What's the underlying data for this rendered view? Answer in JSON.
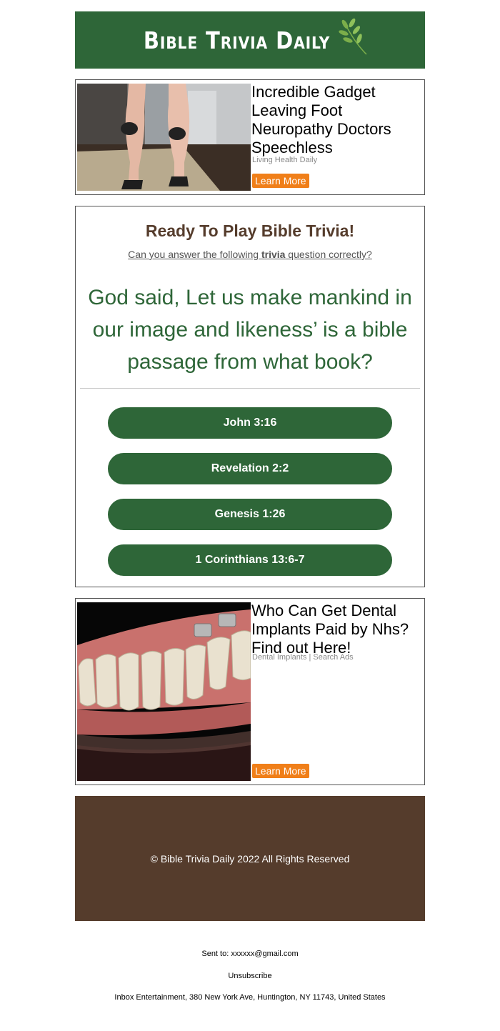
{
  "header": {
    "logo_text": "Bible Trivia Daily",
    "bg_color": "#2e6638"
  },
  "ad1": {
    "title": "Incredible Gadget Leaving Foot Neuropathy Doctors Speechless",
    "source": "Living Health Daily",
    "button_label": "Learn More"
  },
  "trivia": {
    "title": "Ready To Play Bible Trivia!",
    "subtitle_before": "Can you answer the following ",
    "subtitle_bold": "trivia",
    "subtitle_after": " question correctly?",
    "question": "God said, Let us make mankind in our image and likeness’ is a bible passage from what book?",
    "answers": [
      {
        "label": "John 3:16"
      },
      {
        "label": "Revelation 2:2"
      },
      {
        "label": "Genesis 1:26"
      },
      {
        "label": "1 Corinthians 13:6-7"
      }
    ],
    "accent_color": "#2e6638",
    "title_color": "#553c2c"
  },
  "ad2": {
    "title": "Who Can Get Dental Implants Paid by Nhs? Find out Here!",
    "source": "Dental Implants | Search Ads",
    "button_label": "Learn More"
  },
  "footer": {
    "copyright": "© Bible Trivia Daily 2022 All Rights Reserved",
    "bg_color": "#553c2c"
  },
  "email_footer": {
    "sent_to": "Sent to: xxxxxx@gmail.com",
    "unsubscribe": "Unsubscribe",
    "address": "Inbox Entertainment, 380 New York Ave, Huntington, NY 11743, United States"
  }
}
